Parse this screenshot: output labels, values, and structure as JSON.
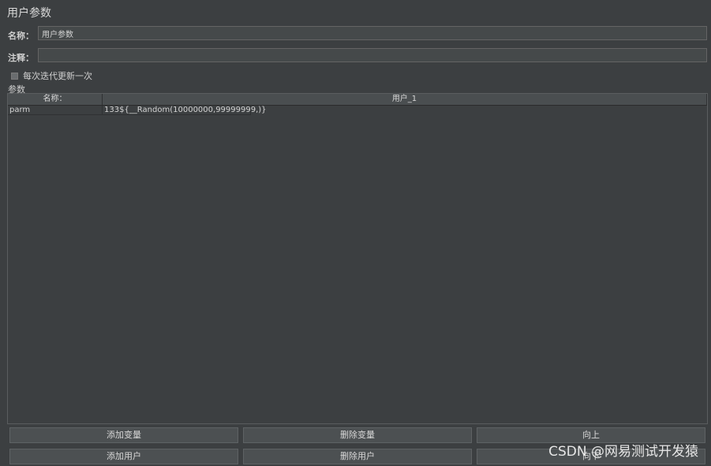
{
  "panel": {
    "title": "用户参数"
  },
  "name_field": {
    "label": "名称：",
    "value": "用户参数"
  },
  "comment_field": {
    "label": "注释：",
    "value": ""
  },
  "update_checkbox": {
    "label": "每次迭代更新一次",
    "checked": false
  },
  "params_section": {
    "label": "参数"
  },
  "table": {
    "columns": [
      "名称：",
      "用户_1"
    ],
    "rows": [
      {
        "name": "parm",
        "user_1": "133${__Random(10000000,99999999,)}"
      }
    ]
  },
  "buttons": {
    "add_variable": "添加变量",
    "delete_variable": "删除变量",
    "move_up": "向上",
    "add_user": "添加用户",
    "delete_user": "删除用户",
    "move_down": "向下"
  },
  "watermark": "CSDN @网易测试开发猿"
}
